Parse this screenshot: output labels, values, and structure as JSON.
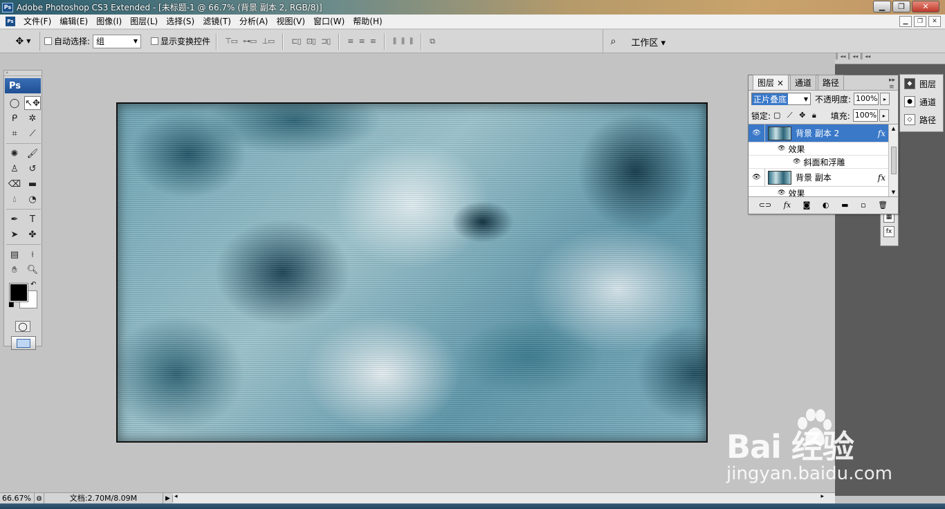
{
  "window": {
    "title": "Adobe Photoshop CS3 Extended - [未标题-1 @ 66.7% (背景 副本 2, RGB/8)]",
    "app_icon": "Ps"
  },
  "menu": [
    "文件(F)",
    "编辑(E)",
    "图像(I)",
    "图层(L)",
    "选择(S)",
    "滤镜(T)",
    "分析(A)",
    "视图(V)",
    "窗口(W)",
    "帮助(H)"
  ],
  "options": {
    "auto_select_label": "自动选择:",
    "auto_select_value": "组",
    "show_transform_label": "显示变换控件",
    "workspace_label": "工作区"
  },
  "toolbox": {
    "logo": "Ps",
    "foreground_color": "#000000",
    "background_color": "#ffffff"
  },
  "layers_panel": {
    "tabs": [
      "图层",
      "通道",
      "路径"
    ],
    "blend_mode": "正片叠底",
    "opacity_label": "不透明度:",
    "opacity_value": "100%",
    "lock_label": "锁定:",
    "fill_label": "填充:",
    "fill_value": "100%",
    "layers": [
      {
        "name": "背景 副本 2",
        "selected": true,
        "has_fx": true,
        "effects_label": "效果",
        "effect": "斜面和浮雕"
      },
      {
        "name": "背景 副本",
        "selected": false,
        "has_fx": true,
        "effects_label": "效果"
      }
    ],
    "fx_symbol": "fx"
  },
  "mini_panel": {
    "items": [
      "图层",
      "通道",
      "路径"
    ]
  },
  "status": {
    "zoom": "66.67%",
    "doc": "文档:2.70M/8.09M"
  },
  "watermark": {
    "brand": "Bai  经验",
    "url": "jingyan.baidu.com"
  },
  "colors": {
    "selection_blue": "#3a78c8",
    "dock_gray": "#5b5b5b",
    "workspace_bg": "#c3c3c3"
  }
}
